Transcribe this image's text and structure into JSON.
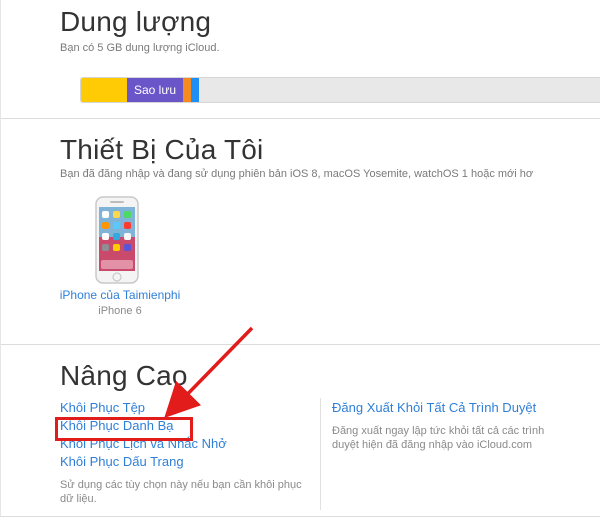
{
  "storage": {
    "title": "Dung lượng",
    "subtitle": "Bạn có 5 GB dung lượng iCloud.",
    "backup_label": "Sao lưu",
    "colors": {
      "photos": "#ffcb05",
      "backup": "#6a56c9",
      "docs": "#f58a1f",
      "mail": "#1f8ff5",
      "free": "#e8e8e8"
    }
  },
  "devices": {
    "title": "Thiết Bị Của Tôi",
    "subtitle": "Bạn đã đăng nhập và đang sử dụng phiên bản iOS 8, macOS Yosemite, watchOS 1 hoặc mới hơ",
    "items": [
      {
        "name": "iPhone của Taimienphi",
        "model": "iPhone 6",
        "icon": "iphone-icon"
      }
    ]
  },
  "advanced": {
    "title": "Nâng Cao",
    "links": [
      "Khôi Phục Tệp",
      "Khôi Phục Danh Bạ",
      "Khôi Phục Lịch và Nhắc Nhở",
      "Khôi Phục Dấu Trang"
    ],
    "help_text": "Sử dụng các tùy chọn này nếu bạn cần khôi phục dữ liệu.",
    "signout_link": "Đăng Xuất Khỏi Tất Cả Trình Duyệt",
    "signout_help": "Đăng xuất ngay lập tức khỏi tất cả các trình duyệt hiện đã đăng nhập vào iCloud.com"
  },
  "annotation": {
    "highlight_color": "#e21b1b"
  }
}
